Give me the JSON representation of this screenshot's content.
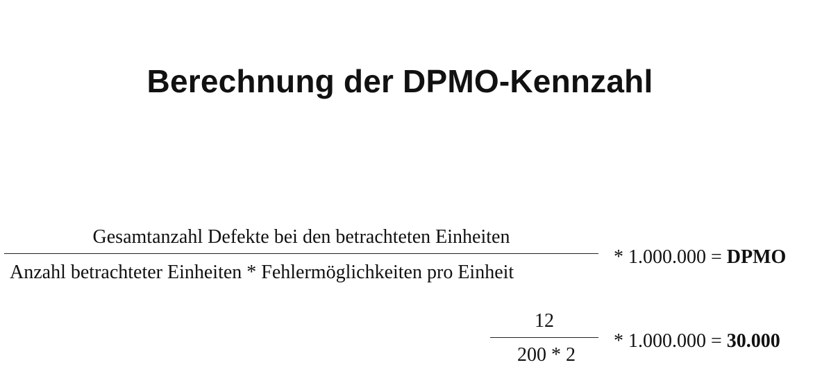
{
  "title": "Berechnung der DPMO-Kennzahl",
  "formula": {
    "numerator": "Gesamtanzahl Defekte bei den betrachteten Einheiten",
    "denominator": "Anzahl betrachteter Einheiten * Fehlermöglichkeiten pro Einheit",
    "multiplier": "* 1.000.000 =",
    "result": "DPMO"
  },
  "example": {
    "numerator": "12",
    "denominator": "200 * 2",
    "multiplier": "* 1.000.000 =",
    "result": "30.000"
  },
  "colors": {
    "text": "#111111",
    "background": "#ffffff"
  }
}
